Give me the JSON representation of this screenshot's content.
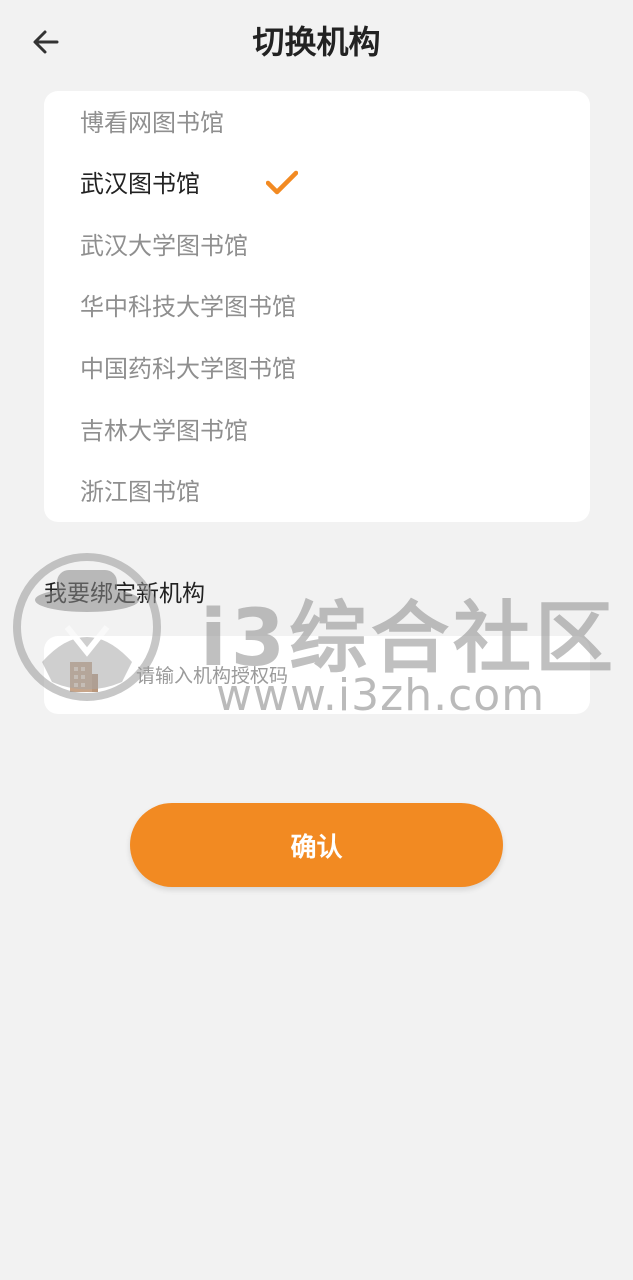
{
  "header": {
    "title": "切换机构",
    "back_icon": "arrow-left-icon"
  },
  "organizations": {
    "items": [
      {
        "label": "博看网图书馆",
        "selected": false
      },
      {
        "label": "武汉图书馆",
        "selected": true
      },
      {
        "label": "武汉大学图书馆",
        "selected": false
      },
      {
        "label": "华中科技大学图书馆",
        "selected": false
      },
      {
        "label": "中国药科大学图书馆",
        "selected": false
      },
      {
        "label": "吉林大学图书馆",
        "selected": false
      },
      {
        "label": "浙江图书馆",
        "selected": false
      }
    ],
    "selected_icon": "checkmark-icon"
  },
  "bind": {
    "label": "我要绑定新机构",
    "input_icon": "building-icon",
    "placeholder": "请输入机构授权码",
    "value": ""
  },
  "confirm": {
    "label": "确认"
  },
  "watermark": {
    "name": "i3综合社区",
    "url": "www.i3zh.com"
  },
  "colors": {
    "accent": "#f28a22",
    "background": "#f2f2f2",
    "card": "#ffffff",
    "selected_text": "#222222",
    "unselected_text": "#8f8f8f"
  }
}
